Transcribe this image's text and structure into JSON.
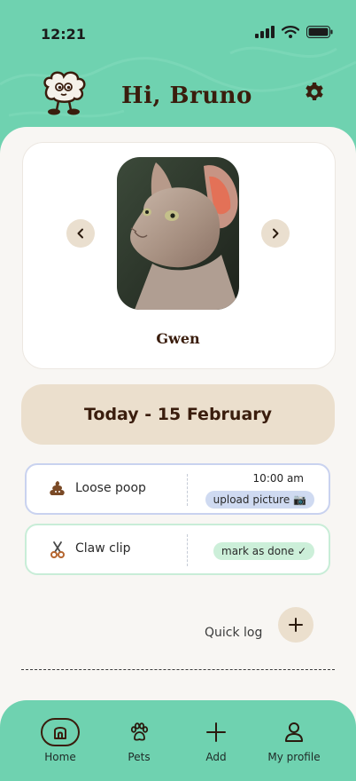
{
  "status_bar": {
    "time": "12:21",
    "icons": [
      "signal-icon",
      "wifi-icon",
      "battery-icon"
    ]
  },
  "header": {
    "greeting": "Hi, Bruno",
    "avatar_icon": "mascot-avatar-icon",
    "settings_icon": "gear-icon"
  },
  "pet_carousel": {
    "pet_name": "Gwen",
    "prev_icon": "chevron-left-icon",
    "next_icon": "chevron-right-icon"
  },
  "date_banner": {
    "text": "Today - 15 February"
  },
  "tasks": [
    {
      "label": "Loose poop",
      "time": "10:00 am",
      "action": "upload picture 📷",
      "icon": "poop-icon"
    },
    {
      "label": "Claw clip",
      "action": "mark as done ✓",
      "icon": "scissors-icon"
    }
  ],
  "quick_log": {
    "label": "Quick log",
    "icon": "plus-icon"
  },
  "nav": [
    {
      "label": "Home",
      "icon": "home-icon",
      "active": true
    },
    {
      "label": "Pets",
      "icon": "paw-icon"
    },
    {
      "label": "Add",
      "icon": "plus-icon"
    },
    {
      "label": "My profile",
      "icon": "user-icon"
    }
  ],
  "colors": {
    "mint": "#6fd2b0",
    "brown": "#3a1d0d",
    "beige": "#ebdfcd",
    "blue_pill": "#cfdaf1",
    "green_pill": "#ccefd9"
  }
}
